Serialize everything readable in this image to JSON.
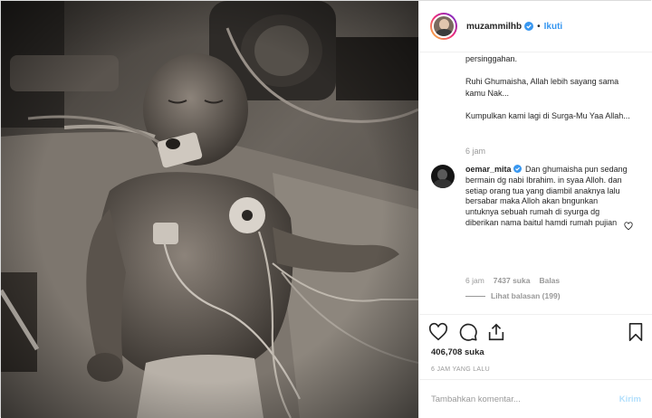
{
  "header": {
    "username": "muzammilhb",
    "separator": "•",
    "follow_label": "Ikuti",
    "verified_color": "#3897f0"
  },
  "caption": {
    "lines": [
      "persinggahan.",
      "Ruhi Ghumaisha, Allah lebih sayang sama kamu Nak...",
      "Kumpulkan kami lagi di Surga-Mu Yaa Allah..."
    ],
    "time": "6 jam"
  },
  "comment": {
    "username": "oemar_mita",
    "text": "Dan ghumaisha pun sedang bermain dg nabi Ibrahim. in syaa Alloh. dan setiap orang tua yang diambil anaknya lalu bersabar maka Alloh akan bngunkan untuknya sebuah rumah di syurga dg diberikan nama baitul hamdi rumah pujian",
    "time": "6 jam",
    "likes": "7437 suka",
    "reply_label": "Balas",
    "view_replies": "Lihat balasan (199)"
  },
  "actions": {
    "icons": [
      "heart-icon",
      "comment-icon",
      "share-icon",
      "bookmark-icon"
    ],
    "likes": "406,708 suka",
    "time_ago": "6 JAM YANG LALU"
  },
  "add_comment": {
    "placeholder": "Tambahkan komentar...",
    "post_label": "Kirim",
    "post_color": "#b2dffc"
  }
}
